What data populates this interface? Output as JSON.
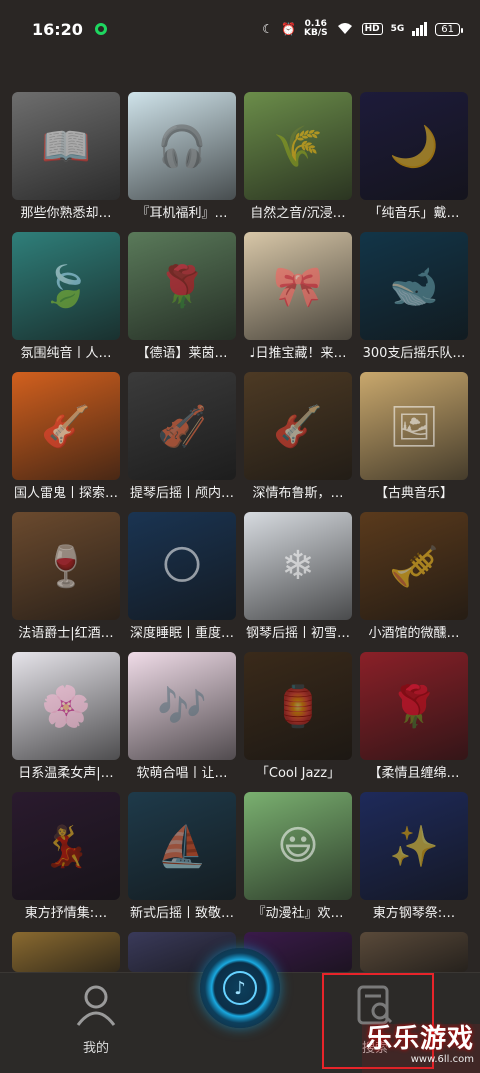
{
  "status": {
    "time": "16:20",
    "speed_value": "0.16",
    "speed_unit": "KB/S",
    "hd": "HD",
    "network": "5G",
    "battery": "61"
  },
  "playlists": [
    {
      "title": "那些你熟悉却…",
      "bg": "#6e6e6e",
      "icon": "person-reading"
    },
    {
      "title": "『耳机福利』…",
      "bg": "#cfe3ea",
      "icon": "anime-girls"
    },
    {
      "title": "自然之音/沉浸…",
      "bg": "#6b8d4a",
      "icon": "grass-field"
    },
    {
      "title": "「纯音乐」戴…",
      "bg": "#1d1b3a",
      "icon": "moon-tree"
    },
    {
      "title": "氛围纯音丨人…",
      "bg": "#2f7f7a",
      "icon": "girl-leaves"
    },
    {
      "title": "【德语】莱茵…",
      "bg": "#5a7a5a",
      "icon": "woman-portrait"
    },
    {
      "title": "♩日推宝藏！来…",
      "bg": "#d8c7a8",
      "icon": "anime-girl"
    },
    {
      "title": "300支后摇乐队…",
      "bg": "#123548",
      "icon": "whale"
    },
    {
      "title": "国人雷鬼丨探索…",
      "bg": "#d2601e",
      "icon": "guitarist"
    },
    {
      "title": "提琴后摇丨颅内…",
      "bg": "#3b3b3b",
      "icon": "silhouette"
    },
    {
      "title": "深情布鲁斯，…",
      "bg": "#4d3a24",
      "icon": "guitar-man"
    },
    {
      "title": "【古典音乐】",
      "bg": "#c9a86d",
      "icon": "painting"
    },
    {
      "title": "法语爵士|红酒…",
      "bg": "#6b4a2e",
      "icon": "dinner"
    },
    {
      "title": "深度睡眠丨重度…",
      "bg": "#1a3452",
      "icon": "full-moon"
    },
    {
      "title": "钢琴后摇丨初雪…",
      "bg": "#d7dbe0",
      "icon": "snow-trees"
    },
    {
      "title": "小酒馆的微醺…",
      "bg": "#5a3a1c",
      "icon": "bar-band"
    },
    {
      "title": "日系温柔女声|…",
      "bg": "#e6e4ea",
      "icon": "anime-girl-2"
    },
    {
      "title": "软萌合唱丨让…",
      "bg": "#f0dce8",
      "icon": "chibi-girls"
    },
    {
      "title": "「Cool Jazz」",
      "bg": "#3a2a1a",
      "icon": "night-street"
    },
    {
      "title": "【柔情且缠绵…",
      "bg": "#8a2028",
      "icon": "rose-man"
    },
    {
      "title": "東方抒情集:…",
      "bg": "#2a1a2e",
      "icon": "dancer"
    },
    {
      "title": "新式后摇丨致敬…",
      "bg": "#1e3a4a",
      "icon": "ship"
    },
    {
      "title": "『动漫社』欢…",
      "bg": "#7ab070",
      "icon": "cartoon"
    },
    {
      "title": "東方钢琴祭:…",
      "bg": "#1e2a5a",
      "icon": "anime-night"
    },
    {
      "title": "",
      "bg": "#8a6a30",
      "icon": "partial"
    },
    {
      "title": "",
      "bg": "#3a3a5a",
      "icon": "partial"
    },
    {
      "title": "",
      "bg": "#3a1a4a",
      "icon": "partial"
    },
    {
      "title": "",
      "bg": "#5a4a3a",
      "icon": "partial"
    }
  ],
  "nav": {
    "mine_label": "我的",
    "search_label": "搜索"
  },
  "watermark": {
    "text": "乐乐游戏",
    "sub": "www.6ll.com"
  }
}
